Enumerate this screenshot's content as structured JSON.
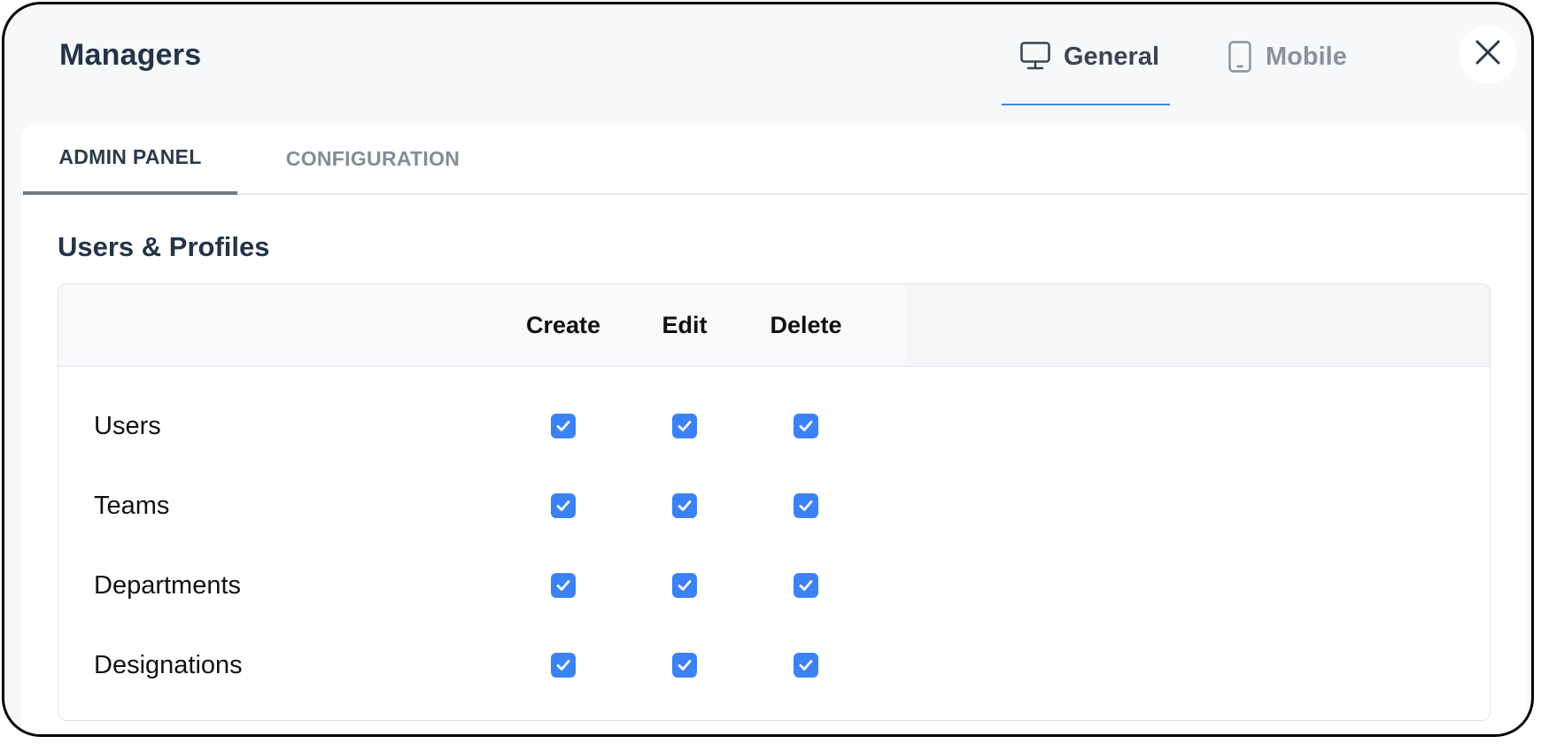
{
  "window": {
    "title": "Managers"
  },
  "view_tabs": [
    {
      "label": "General",
      "icon": "monitor-icon",
      "active": true
    },
    {
      "label": "Mobile",
      "icon": "mobile-icon",
      "active": false
    }
  ],
  "section_tabs": [
    {
      "label": "ADMIN PANEL",
      "active": true
    },
    {
      "label": "CONFIGURATION",
      "active": false
    }
  ],
  "section": {
    "heading": "Users & Profiles",
    "columns": [
      "Create",
      "Edit",
      "Delete"
    ],
    "rows": [
      {
        "label": "Users",
        "create": true,
        "edit": true,
        "delete": true
      },
      {
        "label": "Teams",
        "create": true,
        "edit": true,
        "delete": true
      },
      {
        "label": "Departments",
        "create": true,
        "edit": true,
        "delete": true
      },
      {
        "label": "Designations",
        "create": true,
        "edit": true,
        "delete": true
      }
    ]
  },
  "colors": {
    "accent": "#3b82f6",
    "title_text": "#243447",
    "active_tab_underline": "#3f86e8"
  }
}
